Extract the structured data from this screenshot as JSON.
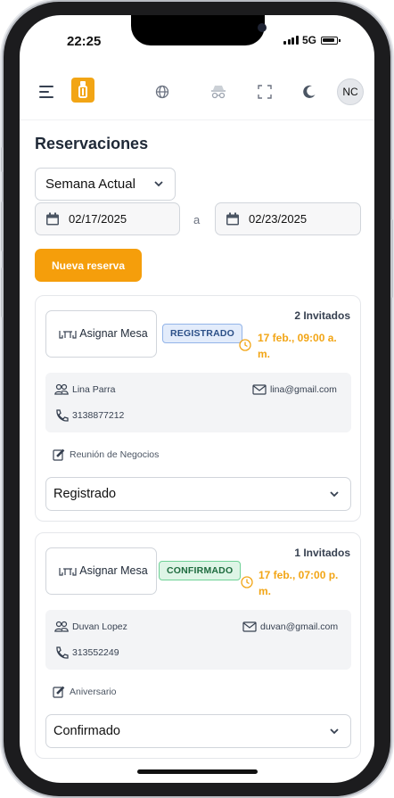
{
  "status_bar": {
    "time": "22:25",
    "network": "5G"
  },
  "header": {
    "icons": [
      "menu-icon",
      "app-logo",
      "globe-icon",
      "incognito-icon",
      "fullscreen-icon",
      "moon-icon"
    ],
    "avatar_initials": "NC"
  },
  "page": {
    "title": "Reservaciones",
    "week_filter": "Semana Actual",
    "date_from": "02/17/2025",
    "date_separator": "a",
    "date_to": "02/23/2025",
    "new_button": "Nueva reserva"
  },
  "reservations": [
    {
      "assign_label": "Asignar Mesa",
      "badge": "REGISTRADO",
      "guests": "2 Invitados",
      "time_line1": "17 feb., 09:00 a.",
      "time_line2": "m.",
      "name": "Lina Parra",
      "email": "lina@gmail.com",
      "phone": "3138877212",
      "note": "Reunión de Negocios",
      "status": "Registrado"
    },
    {
      "assign_label": "Asignar Mesa",
      "badge": "CONFIRMADO",
      "guests": "1 Invitados",
      "time_line1": "17 feb., 07:00 p.",
      "time_line2": "m.",
      "name": "Duvan Lopez",
      "email": "duvan@gmail.com",
      "phone": "313552249",
      "note": "Aniversario",
      "status": "Confirmado"
    }
  ],
  "colors": {
    "accent": "#f59e0b",
    "time_text": "#f2a515",
    "badge_registered": "#e3ecfb",
    "badge_confirmed": "#def5e6"
  }
}
